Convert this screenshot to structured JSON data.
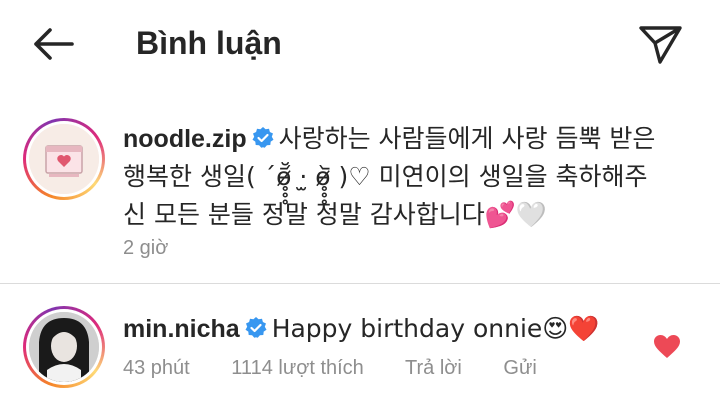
{
  "header": {
    "title": "Bình luận",
    "back_icon": "arrow-left-icon",
    "send_icon": "paper-plane-icon"
  },
  "caption": {
    "username": "noodle.zip",
    "verified": true,
    "text": "사랑하는 사람들에게 사랑 듬뿍 받은 행복한 생일( ´ɵ̷̥̥̥᷄̆ ·̫ ɵ̷̥̥̥᷅ )♡ 미연이의 생일을 축하해주신 모든 분들 정말 정말 감사합니다💕🤍",
    "time": "2 giờ"
  },
  "reply": {
    "username": "min.nicha",
    "verified": true,
    "text": "Happy birthday onnie😍❤️",
    "time": "43 phút",
    "likes": "1114 lượt thích",
    "reply_label": "Trả lời",
    "send_label": "Gửi",
    "liked": true
  },
  "colors": {
    "text": "#262626",
    "secondary": "#8e8e8e",
    "verified_blue": "#3897f0",
    "like_red": "#ed4956",
    "divider": "#dbdbdb"
  }
}
